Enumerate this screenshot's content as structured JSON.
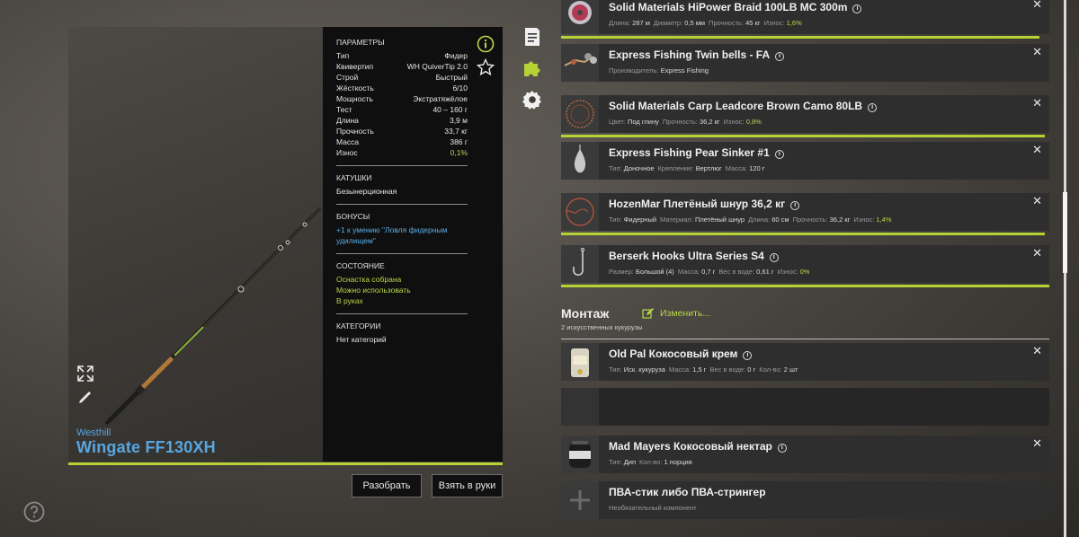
{
  "rod": {
    "brand": "Westhill",
    "name": "Wingate FF130XH"
  },
  "params": {
    "header": "ПАРАМЕТРЫ",
    "rows": [
      {
        "label": "Тип",
        "value": "Фидер"
      },
      {
        "label": "Квивертип",
        "value": "WH QuiverTip 2.0"
      },
      {
        "label": "Строй",
        "value": "Быстрый"
      },
      {
        "label": "Жёсткость",
        "value": "6/10"
      },
      {
        "label": "Мощность",
        "value": "Экстратяжёлое"
      },
      {
        "label": "Тест",
        "value": "40 – 160 г"
      },
      {
        "label": "Длина",
        "value": "3,9 м"
      },
      {
        "label": "Прочность",
        "value": "33,7 кг"
      },
      {
        "label": "Масса",
        "value": "386 г"
      },
      {
        "label": "Износ",
        "value": "0,1%"
      }
    ],
    "reels_header": "КАТУШКИ",
    "reels_value": "Безынерционная",
    "bonus_header": "БОНУСЫ",
    "bonus_value": "+1 к умению \"Ловля фидерным удилищем\"",
    "state_header": "СОСТОЯНИЕ",
    "state_values": [
      "Оснастка собрана",
      "Можно использовать",
      "В руках"
    ],
    "categories_header": "КАТЕГОРИИ",
    "categories_value": "Нет категорий"
  },
  "buttons": {
    "disassemble": "Разобрать",
    "take": "Взять в руки"
  },
  "items": [
    {
      "title": "Solid Materials HiPower Braid 100LB MC 300m",
      "meta": [
        {
          "k": "Длина:",
          "v": "287 м"
        },
        {
          "k": "Диаметр:",
          "v": "0,5 мм"
        },
        {
          "k": "Прочность:",
          "v": "45 кг"
        },
        {
          "k": "Износ:",
          "v": "1,6%",
          "green": true
        }
      ],
      "wear": 0.984
    },
    {
      "title": "Express Fishing Twin bells - FA",
      "meta": [
        {
          "k": "Производитель:",
          "v": "Express Fishing"
        }
      ]
    },
    {
      "title": "Solid Materials Carp Leadcore Brown Camo 80LB",
      "meta": [
        {
          "k": "Цвет:",
          "v": "Под глину"
        },
        {
          "k": "Прочность:",
          "v": "36,2 кг"
        },
        {
          "k": "Износ:",
          "v": "0,8%",
          "green": true
        }
      ],
      "wear": 0.992
    },
    {
      "title": "Express Fishing Pear Sinker #1",
      "meta": [
        {
          "k": "Тип:",
          "v": "Доночное"
        },
        {
          "k": "Крепление:",
          "v": "Вертлюг"
        },
        {
          "k": "Масса:",
          "v": "120 г"
        }
      ]
    },
    {
      "title": "HozenMar Плетёный шнур 36,2 кг",
      "meta": [
        {
          "k": "Тип:",
          "v": "Фидерный"
        },
        {
          "k": "Материал:",
          "v": "Плетёный шнур"
        },
        {
          "k": "Длина:",
          "v": "60 см"
        },
        {
          "k": "Прочность:",
          "v": "36,2 кг"
        },
        {
          "k": "Износ:",
          "v": "1,4%",
          "green": true
        }
      ],
      "wear": 0.986
    },
    {
      "title": "Berserk Hooks Ultra Series S4",
      "meta": [
        {
          "k": "Размер:",
          "v": "Большой (4)"
        },
        {
          "k": "Масса:",
          "v": "0,7 г"
        },
        {
          "k": "Вес в воде:",
          "v": "0,61 г"
        },
        {
          "k": "Износ:",
          "v": "0%",
          "green": true
        }
      ],
      "wear": 1.0
    }
  ],
  "montage": {
    "title": "Монтаж",
    "edit": "Изменить...",
    "sub": "2 искусственных кукурузы"
  },
  "bait_items": [
    {
      "title": "Old Pal Кокосовый крем",
      "meta": [
        {
          "k": "Тип:",
          "v": "Иск. кукуруза"
        },
        {
          "k": "Масса:",
          "v": "1,5 г"
        },
        {
          "k": "Вес в воде:",
          "v": "0 г"
        },
        {
          "k": "Кол-во:",
          "v": "2 шт"
        }
      ]
    },
    {
      "title": "Mad Mayers Кокосовый нектар",
      "meta": [
        {
          "k": "Тип:",
          "v": "Дип"
        },
        {
          "k": "Кол-во:",
          "v": "1 порция"
        }
      ]
    },
    {
      "title": "ПВА-стик либо ПВА-стрингер",
      "meta": [
        {
          "k": "",
          "v": "Необязательный компонент"
        }
      ]
    }
  ],
  "colors": {
    "accent": "#b5d334",
    "blue": "#58a6e0",
    "green_text": "#b9d84a"
  }
}
